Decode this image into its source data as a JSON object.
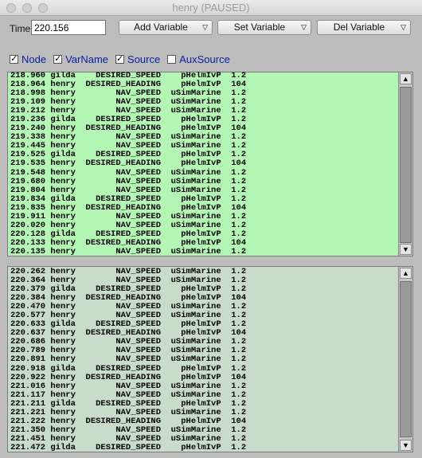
{
  "window": {
    "title": "henry (PAUSED)"
  },
  "toolbar": {
    "time_label": "Time:",
    "time_value": "220.156",
    "add_variable": "Add Variable",
    "set_variable": "Set Variable",
    "del_variable": "Del Variable",
    "menu_indicator": "▽"
  },
  "columns": [
    {
      "label": "Node",
      "checked": true
    },
    {
      "label": "VarName",
      "checked": true
    },
    {
      "label": "Source",
      "checked": true
    },
    {
      "label": "AuxSource",
      "checked": false
    }
  ],
  "colors": {
    "history_pane": "#b4f7b4",
    "live_pane": "#c9dcc9",
    "column_label": "#0a1ea0"
  },
  "history_pane": {
    "rows": [
      [
        "218.960",
        "gilda",
        "DESIRED_SPEED",
        "pHelmIvP",
        "1.2"
      ],
      [
        "218.964",
        "henry",
        "DESIRED_HEADING",
        "pHelmIvP",
        "104"
      ],
      [
        "218.998",
        "henry",
        "NAV_SPEED",
        "uSimMarine",
        "1.2"
      ],
      [
        "219.109",
        "henry",
        "NAV_SPEED",
        "uSimMarine",
        "1.2"
      ],
      [
        "219.212",
        "henry",
        "NAV_SPEED",
        "uSimMarine",
        "1.2"
      ],
      [
        "219.236",
        "gilda",
        "DESIRED_SPEED",
        "pHelmIvP",
        "1.2"
      ],
      [
        "219.240",
        "henry",
        "DESIRED_HEADING",
        "pHelmIvP",
        "104"
      ],
      [
        "219.338",
        "henry",
        "NAV_SPEED",
        "uSimMarine",
        "1.2"
      ],
      [
        "219.445",
        "henry",
        "NAV_SPEED",
        "uSimMarine",
        "1.2"
      ],
      [
        "219.525",
        "gilda",
        "DESIRED_SPEED",
        "pHelmIvP",
        "1.2"
      ],
      [
        "219.535",
        "henry",
        "DESIRED_HEADING",
        "pHelmIvP",
        "104"
      ],
      [
        "219.548",
        "henry",
        "NAV_SPEED",
        "uSimMarine",
        "1.2"
      ],
      [
        "219.680",
        "henry",
        "NAV_SPEED",
        "uSimMarine",
        "1.2"
      ],
      [
        "219.804",
        "henry",
        "NAV_SPEED",
        "uSimMarine",
        "1.2"
      ],
      [
        "219.834",
        "gilda",
        "DESIRED_SPEED",
        "pHelmIvP",
        "1.2"
      ],
      [
        "219.835",
        "henry",
        "DESIRED_HEADING",
        "pHelmIvP",
        "104"
      ],
      [
        "219.911",
        "henry",
        "NAV_SPEED",
        "uSimMarine",
        "1.2"
      ],
      [
        "220.020",
        "henry",
        "NAV_SPEED",
        "uSimMarine",
        "1.2"
      ],
      [
        "220.128",
        "gilda",
        "DESIRED_SPEED",
        "pHelmIvP",
        "1.2"
      ],
      [
        "220.133",
        "henry",
        "DESIRED_HEADING",
        "pHelmIvP",
        "104"
      ],
      [
        "220.135",
        "henry",
        "NAV_SPEED",
        "uSimMarine",
        "1.2"
      ]
    ]
  },
  "live_pane": {
    "rows": [
      [
        "220.262",
        "henry",
        "NAV_SPEED",
        "uSimMarine",
        "1.2"
      ],
      [
        "220.364",
        "henry",
        "NAV_SPEED",
        "uSimMarine",
        "1.2"
      ],
      [
        "220.379",
        "gilda",
        "DESIRED_SPEED",
        "pHelmIvP",
        "1.2"
      ],
      [
        "220.384",
        "henry",
        "DESIRED_HEADING",
        "pHelmIvP",
        "104"
      ],
      [
        "220.470",
        "henry",
        "NAV_SPEED",
        "uSimMarine",
        "1.2"
      ],
      [
        "220.577",
        "henry",
        "NAV_SPEED",
        "uSimMarine",
        "1.2"
      ],
      [
        "220.633",
        "gilda",
        "DESIRED_SPEED",
        "pHelmIvP",
        "1.2"
      ],
      [
        "220.637",
        "henry",
        "DESIRED_HEADING",
        "pHelmIvP",
        "104"
      ],
      [
        "220.686",
        "henry",
        "NAV_SPEED",
        "uSimMarine",
        "1.2"
      ],
      [
        "220.789",
        "henry",
        "NAV_SPEED",
        "uSimMarine",
        "1.2"
      ],
      [
        "220.891",
        "henry",
        "NAV_SPEED",
        "uSimMarine",
        "1.2"
      ],
      [
        "220.918",
        "gilda",
        "DESIRED_SPEED",
        "pHelmIvP",
        "1.2"
      ],
      [
        "220.922",
        "henry",
        "DESIRED_HEADING",
        "pHelmIvP",
        "104"
      ],
      [
        "221.016",
        "henry",
        "NAV_SPEED",
        "uSimMarine",
        "1.2"
      ],
      [
        "221.117",
        "henry",
        "NAV_SPEED",
        "uSimMarine",
        "1.2"
      ],
      [
        "221.211",
        "gilda",
        "DESIRED_SPEED",
        "pHelmIvP",
        "1.2"
      ],
      [
        "221.221",
        "henry",
        "NAV_SPEED",
        "uSimMarine",
        "1.2"
      ],
      [
        "221.222",
        "henry",
        "DESIRED_HEADING",
        "pHelmIvP",
        "104"
      ],
      [
        "221.350",
        "henry",
        "NAV_SPEED",
        "uSimMarine",
        "1.2"
      ],
      [
        "221.451",
        "henry",
        "NAV_SPEED",
        "uSimMarine",
        "1.2"
      ],
      [
        "221.472",
        "gilda",
        "DESIRED_SPEED",
        "pHelmIvP",
        "1.2"
      ]
    ]
  },
  "scrollbar": {
    "up_glyph": "▲",
    "down_glyph": "▼"
  }
}
